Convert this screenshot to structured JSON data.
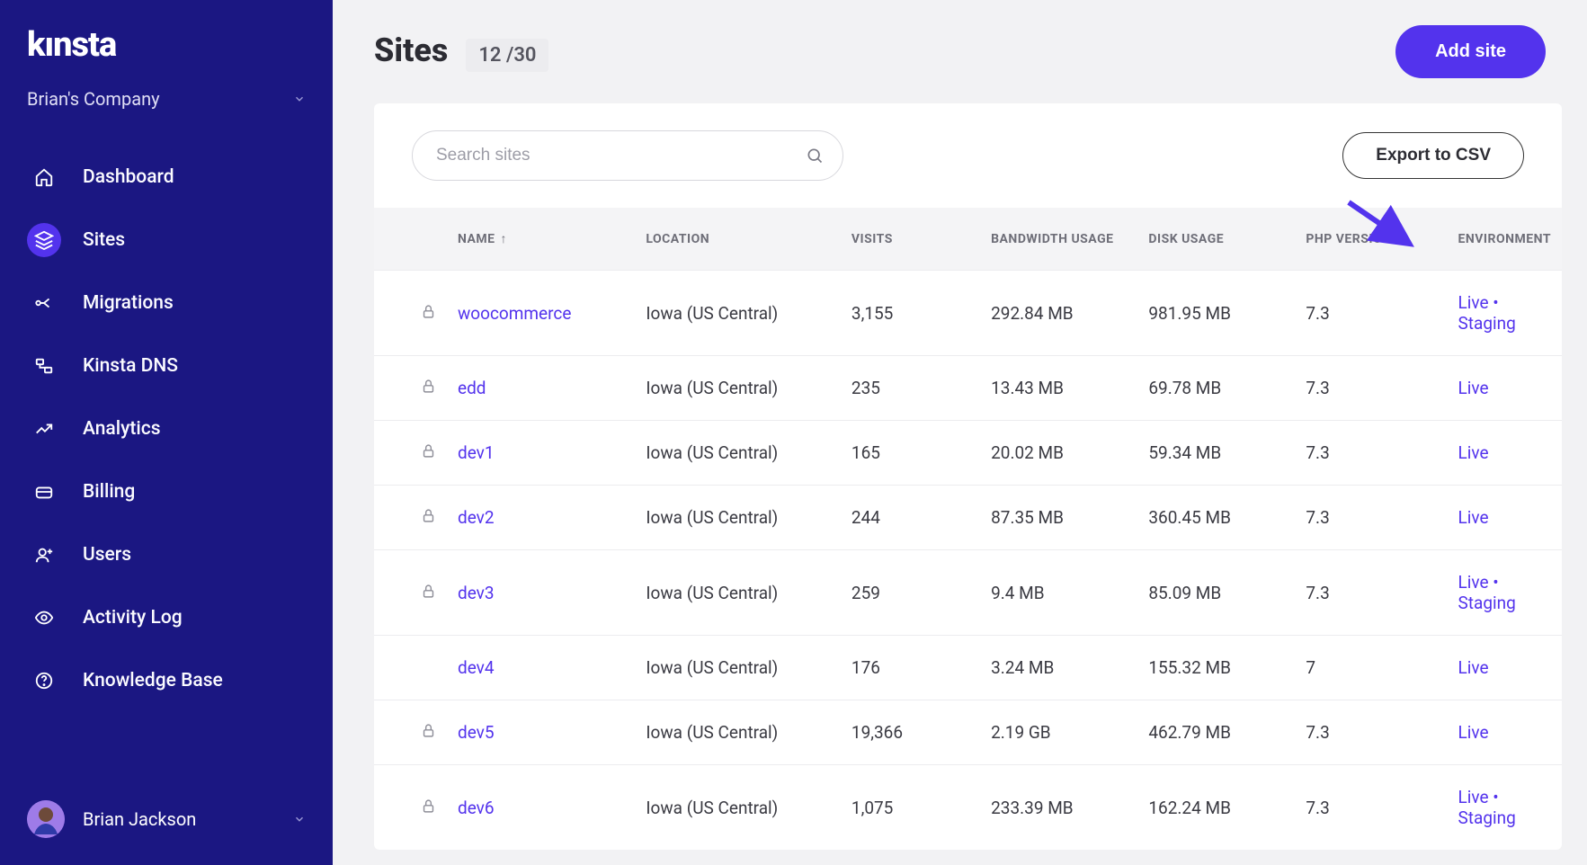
{
  "sidebar": {
    "logo_text": "kınsta",
    "company_name": "Brian's Company",
    "nav": [
      {
        "label": "Dashboard",
        "icon": "home-icon"
      },
      {
        "label": "Sites",
        "icon": "layers-icon"
      },
      {
        "label": "Migrations",
        "icon": "merge-icon"
      },
      {
        "label": "Kinsta DNS",
        "icon": "dns-icon"
      },
      {
        "label": "Analytics",
        "icon": "analytics-icon"
      },
      {
        "label": "Billing",
        "icon": "billing-icon"
      },
      {
        "label": "Users",
        "icon": "users-icon"
      },
      {
        "label": "Activity Log",
        "icon": "eye-icon"
      },
      {
        "label": "Knowledge Base",
        "icon": "help-icon"
      }
    ],
    "user_name": "Brian Jackson"
  },
  "header": {
    "title": "Sites",
    "count": "12 /30",
    "add_btn": "Add site"
  },
  "toolbar": {
    "search_placeholder": "Search sites",
    "export_btn": "Export to CSV"
  },
  "table": {
    "headers": {
      "name": "NAME",
      "location": "LOCATION",
      "visits": "VISITS",
      "bandwidth": "BANDWIDTH USAGE",
      "disk": "DISK USAGE",
      "php": "PHP VERSION",
      "env": "ENVIRONMENT"
    },
    "rows": [
      {
        "locked": true,
        "name": "woocommerce",
        "location": "Iowa (US Central)",
        "visits": "3,155",
        "bandwidth": "292.84 MB",
        "disk": "981.95 MB",
        "php": "7.3",
        "env": [
          "Live",
          "Staging"
        ]
      },
      {
        "locked": true,
        "name": "edd",
        "location": "Iowa (US Central)",
        "visits": "235",
        "bandwidth": "13.43 MB",
        "disk": "69.78 MB",
        "php": "7.3",
        "env": [
          "Live"
        ]
      },
      {
        "locked": true,
        "name": "dev1",
        "location": "Iowa (US Central)",
        "visits": "165",
        "bandwidth": "20.02 MB",
        "disk": "59.34 MB",
        "php": "7.3",
        "env": [
          "Live"
        ]
      },
      {
        "locked": true,
        "name": "dev2",
        "location": "Iowa (US Central)",
        "visits": "244",
        "bandwidth": "87.35 MB",
        "disk": "360.45 MB",
        "php": "7.3",
        "env": [
          "Live"
        ]
      },
      {
        "locked": true,
        "name": "dev3",
        "location": "Iowa (US Central)",
        "visits": "259",
        "bandwidth": "9.4 MB",
        "disk": "85.09 MB",
        "php": "7.3",
        "env": [
          "Live",
          "Staging"
        ]
      },
      {
        "locked": false,
        "name": "dev4",
        "location": "Iowa (US Central)",
        "visits": "176",
        "bandwidth": "3.24 MB",
        "disk": "155.32 MB",
        "php": "7",
        "env": [
          "Live"
        ]
      },
      {
        "locked": true,
        "name": "dev5",
        "location": "Iowa (US Central)",
        "visits": "19,366",
        "bandwidth": "2.19 GB",
        "disk": "462.79 MB",
        "php": "7.3",
        "env": [
          "Live"
        ]
      },
      {
        "locked": true,
        "name": "dev6",
        "location": "Iowa (US Central)",
        "visits": "1,075",
        "bandwidth": "233.39 MB",
        "disk": "162.24 MB",
        "php": "7.3",
        "env": [
          "Live",
          "Staging"
        ]
      }
    ]
  }
}
